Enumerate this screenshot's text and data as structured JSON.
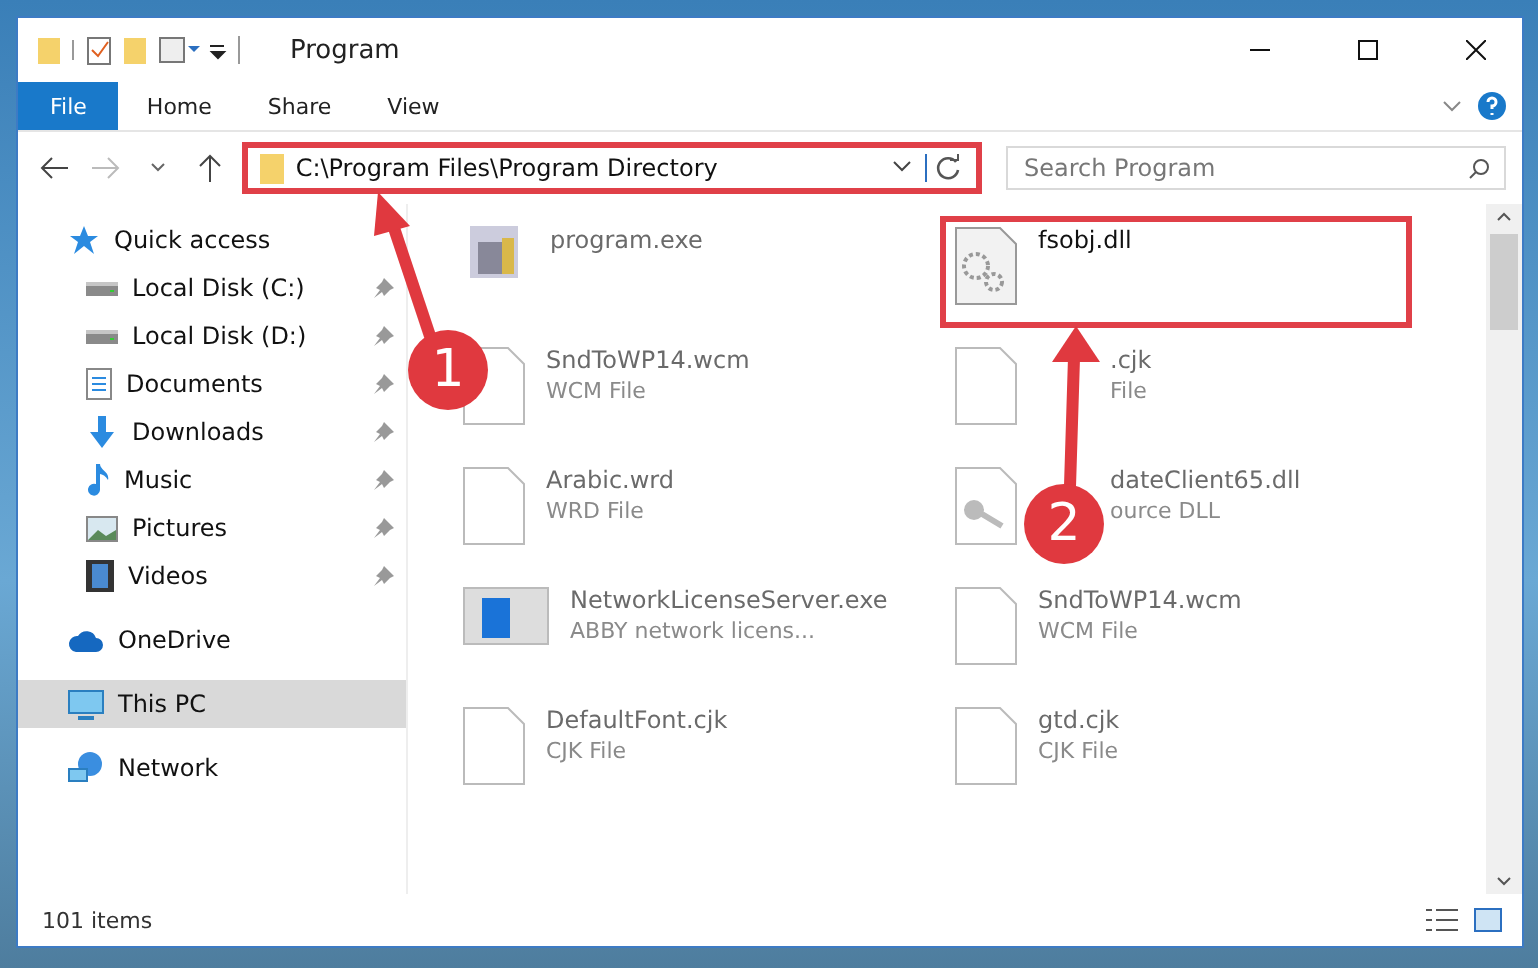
{
  "window": {
    "title": "Program"
  },
  "ribbon_tabs": [
    {
      "label": "File",
      "kind": "file"
    },
    {
      "label": "Home",
      "kind": "tab"
    },
    {
      "label": "Share",
      "kind": "tab"
    },
    {
      "label": "View",
      "kind": "tab"
    }
  ],
  "address": {
    "path": "C:\\Program Files\\Program Directory"
  },
  "search": {
    "placeholder": "Search Program"
  },
  "sidebar": {
    "items": [
      {
        "label": "Quick access",
        "kind": "star",
        "selected": false,
        "children": [
          {
            "label": "Local Disk (C:)",
            "kind": "disk",
            "pinned": true
          },
          {
            "label": "Local Disk (D:)",
            "kind": "disk",
            "pinned": true
          },
          {
            "label": "Documents",
            "kind": "doc",
            "pinned": true
          },
          {
            "label": "Downloads",
            "kind": "download",
            "pinned": true
          },
          {
            "label": "Music",
            "kind": "music",
            "pinned": true
          },
          {
            "label": "Pictures",
            "kind": "pictures",
            "pinned": true
          },
          {
            "label": "Videos",
            "kind": "videos",
            "pinned": true
          }
        ]
      },
      {
        "label": "OneDrive",
        "kind": "cloud",
        "selected": false
      },
      {
        "label": "This PC",
        "kind": "pc",
        "selected": true
      },
      {
        "label": "Network",
        "kind": "network",
        "selected": false
      }
    ]
  },
  "files": [
    {
      "name": "program.exe",
      "kind": "exe",
      "highlighted": false
    },
    {
      "name": "fsobj.dll",
      "kind": "gear",
      "highlighted": true
    },
    {
      "name": "SndToWP14.wcm",
      "type": "WCM File",
      "kind": "file",
      "highlighted": false
    },
    {
      "name": ".cjk",
      "type": "File",
      "kind": "file",
      "highlighted": false,
      "covered": true
    },
    {
      "name": "Arabic.wrd",
      "type": "WRD File",
      "kind": "file",
      "highlighted": false
    },
    {
      "name": "dateClient65.dll",
      "type": "ource DLL",
      "kind": "key",
      "highlighted": false,
      "covered": true
    },
    {
      "name": "NetworkLicenseServer.exe",
      "type": "ABBY network licens...",
      "kind": "window",
      "highlighted": false
    },
    {
      "name": "SndToWP14.wcm",
      "type": "WCM File",
      "kind": "file",
      "highlighted": false
    },
    {
      "name": "DefaultFont.cjk",
      "type": "CJK File",
      "kind": "file",
      "highlighted": false
    },
    {
      "name": "gtd.cjk",
      "type": "CJK File",
      "kind": "file",
      "highlighted": false
    }
  ],
  "status_bar": {
    "count": "101 items"
  },
  "markers": [
    {
      "label": "1"
    },
    {
      "label": "2"
    }
  ]
}
